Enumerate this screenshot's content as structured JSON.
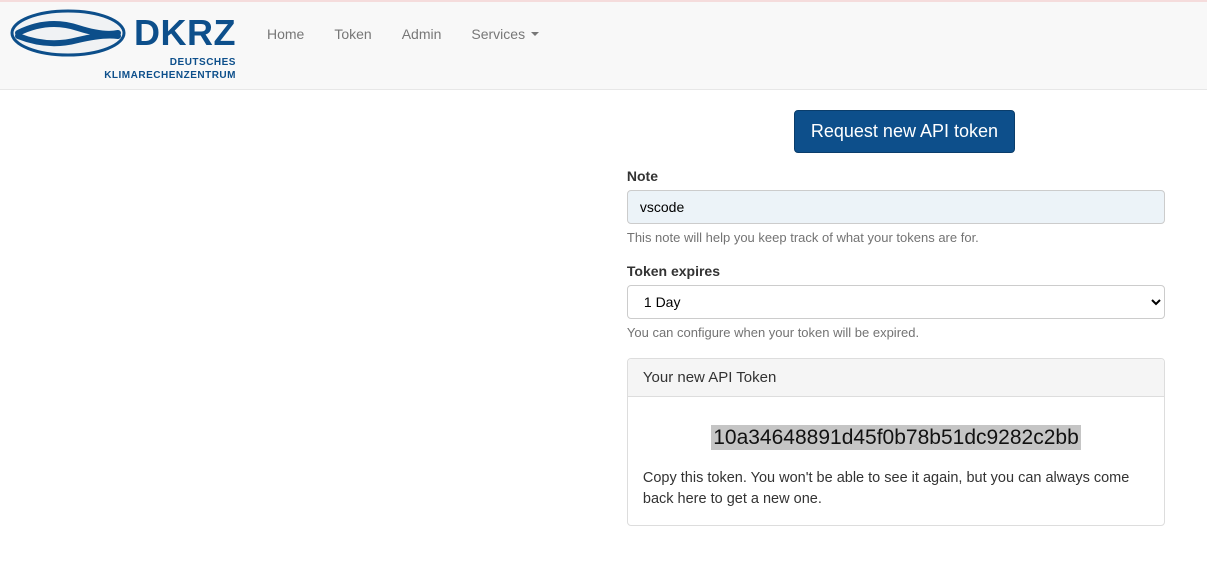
{
  "brand": {
    "name": "DKRZ",
    "sub1": "DEUTSCHES",
    "sub2": "KLIMARECHENZENTRUM"
  },
  "nav": {
    "home": "Home",
    "token": "Token",
    "admin": "Admin",
    "services": "Services"
  },
  "form": {
    "request_btn": "Request new API token",
    "note_label": "Note",
    "note_value": "vscode",
    "note_help": "This note will help you keep track of what your tokens are for.",
    "expires_label": "Token expires",
    "expires_value": "1 Day",
    "expires_help": "You can configure when your token will be expired."
  },
  "panel": {
    "title": "Your new API Token",
    "token": "10a34648891d45f0b78b51dc9282c2bb",
    "message": "Copy this token. You won't be able to see it again, but you can always come back here to get a new one."
  }
}
